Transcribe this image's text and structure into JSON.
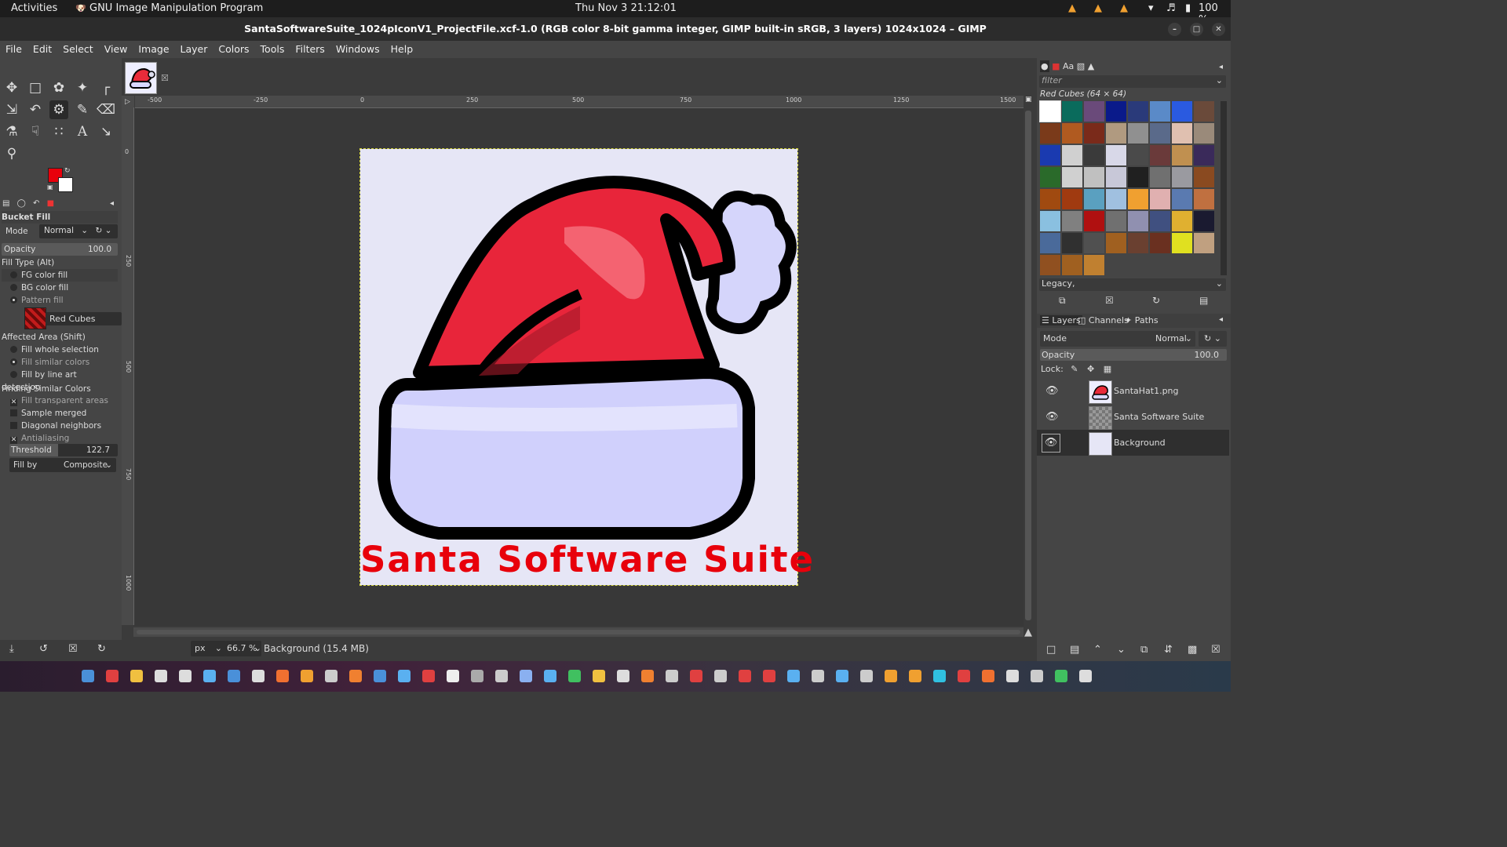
{
  "topbar": {
    "activities": "Activities",
    "app_name": "GNU Image Manipulation Program",
    "clock": "Thu Nov 3  21:12:01",
    "battery": "100 %"
  },
  "window": {
    "title": "SantaSoftwareSuite_1024pIconV1_ProjectFile.xcf-1.0 (RGB color 8-bit gamma integer, GIMP built-in sRGB, 3 layers) 1024x1024 – GIMP"
  },
  "menu": [
    "File",
    "Edit",
    "Select",
    "View",
    "Image",
    "Layer",
    "Colors",
    "Tools",
    "Filters",
    "Windows",
    "Help"
  ],
  "tool_options": {
    "title": "Bucket Fill",
    "mode_label": "Mode",
    "mode_value": "Normal",
    "opacity_label": "Opacity",
    "opacity_value": "100.0",
    "fill_type_label": "Fill Type  (Alt)",
    "fill_types": [
      "FG color fill",
      "BG color fill",
      "Pattern fill"
    ],
    "pattern_name": "Red Cubes",
    "affected_label": "Affected Area  (Shift)",
    "affected": [
      "Fill whole selection",
      "Fill similar colors",
      "Fill by line art detection"
    ],
    "similar_label": "Finding Similar Colors",
    "similar": [
      "Fill transparent areas",
      "Sample merged",
      "Diagonal neighbors",
      "Antialiasing"
    ],
    "threshold_label": "Threshold",
    "threshold_value": "122.7",
    "fillby_label": "Fill by",
    "fillby_value": "Composite"
  },
  "colors": {
    "fg": "#e8000b",
    "bg": "#ffffff"
  },
  "ruler": {
    "labels": [
      "-500",
      "-250",
      "0",
      "250",
      "500",
      "750",
      "1000",
      "1250",
      "1500"
    ]
  },
  "ruler_left": {
    "labels": [
      "0",
      "250",
      "500",
      "750",
      "1000"
    ]
  },
  "canvas": {
    "text": "Santa Software Suite"
  },
  "status": {
    "unit": "px",
    "zoom": "66.7 %",
    "message": "Background (15.4 MB)"
  },
  "patterns": {
    "filter_placeholder": "filter",
    "title": "Red Cubes (64 × 64)",
    "tag": "Legacy,"
  },
  "layers": {
    "tabs": [
      "Layers",
      "Channels",
      "Paths"
    ],
    "mode_label": "Mode",
    "mode_value": "Normal",
    "opacity_label": "Opacity",
    "opacity_value": "100.0",
    "lock_label": "Lock:",
    "items": [
      "SantaHat1.png",
      "Santa Software Suite",
      "Background"
    ]
  }
}
